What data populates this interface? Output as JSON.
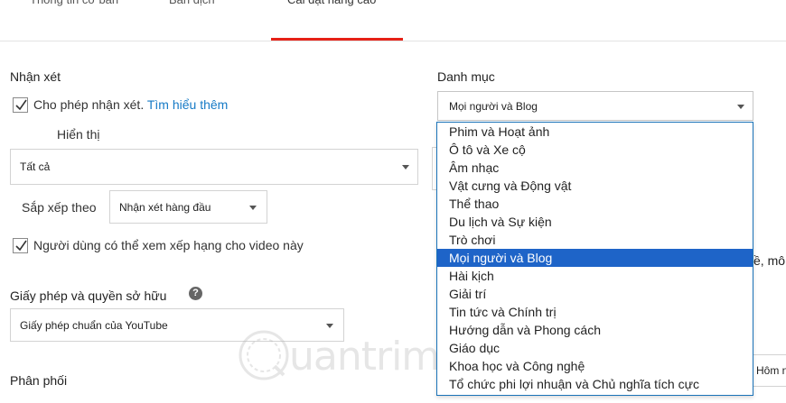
{
  "tabs": [
    {
      "label": "Thông tin cơ bản"
    },
    {
      "label": "Bản dịch"
    },
    {
      "label": "Cài đặt nâng cao",
      "active": true
    }
  ],
  "comments": {
    "title": "Nhận xét",
    "allow_label": "Cho phép nhận xét.",
    "learn_more": "Tìm hiểu thêm",
    "display_label": "Hiển thị",
    "display_value": "Tất cả",
    "sort_label": "Sắp xếp theo",
    "sort_value": "Nhận xét hàng đầu",
    "ratings_label": "Người dùng có thể xem xếp hạng cho video này"
  },
  "license": {
    "title": "Giấy phép và quyền sở hữu",
    "help_icon": "?",
    "value": "Giấy phép chuẩn của YouTube"
  },
  "distribution": {
    "title": "Phân phối"
  },
  "category": {
    "title": "Danh mục",
    "selected": "Mọi người và Blog",
    "options": [
      "Phim và Hoạt ảnh",
      "Ô tô và Xe cộ",
      "Âm nhạc",
      "Vật cưng và Động vật",
      "Thể thao",
      "Du lịch và Sự kiện",
      "Trò chơi",
      "Mọi người và Blog",
      "Hài kịch",
      "Giải trí",
      "Tin tức và Chính trị",
      "Hướng dẫn và Phong cách",
      "Giáo dục",
      "Khoa học và Công nghệ",
      "Tổ chức phi lợi nhuận và Chủ nghĩa tích cực"
    ]
  },
  "partial": {
    "right_text": "ề, mô",
    "right_button": "Hôm n"
  },
  "watermark": {
    "text": "uantrimang"
  },
  "colors": {
    "accent_red": "#e62117",
    "link_blue": "#167ac6",
    "selected_bg": "#1e64c8",
    "dropdown_border": "#1a73b8"
  },
  "icons": {
    "checkbox": "checkmark-icon",
    "caret": "caret-down-icon",
    "help": "help-circle-icon"
  }
}
